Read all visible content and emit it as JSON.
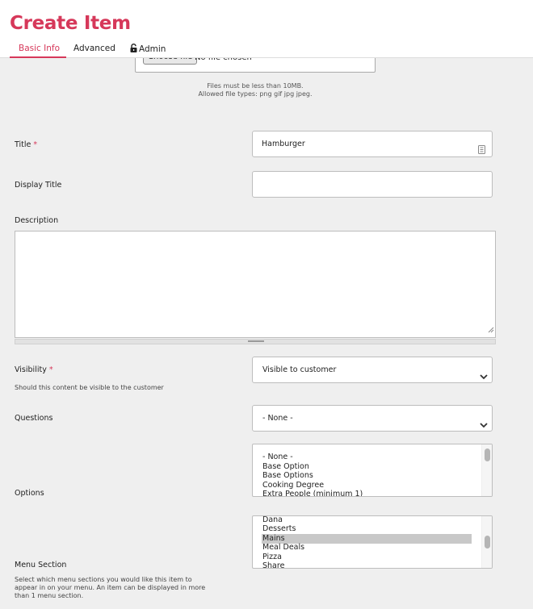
{
  "header": {
    "title": "Create Item",
    "tabs": [
      {
        "label": "Basic Info",
        "active": true
      },
      {
        "label": "Advanced",
        "active": false
      },
      {
        "label": "Admin",
        "active": false,
        "icon": "lock-icon"
      }
    ]
  },
  "image_upload": {
    "button_label": "Choose file",
    "status_text": "No file chosen",
    "help_lines": [
      "Files must be less than 10MB.",
      "Allowed file types: png gif jpg jpeg."
    ]
  },
  "form": {
    "required_marker": "*",
    "title": {
      "label": "Title",
      "value": "Hamburger"
    },
    "display_title": {
      "label": "Display Title",
      "value": ""
    },
    "description": {
      "label": "Description",
      "value": ""
    },
    "visibility": {
      "label": "Visibility",
      "selected": "Visible to customer",
      "hint": "Should this content be visible to the customer"
    },
    "questions": {
      "label": "Questions",
      "selected": "- None -"
    },
    "options": {
      "label": "Options",
      "items": [
        "- None -",
        "Base Option",
        "Base Options",
        "Cooking Degree",
        "Extra People (minimum 1)"
      ]
    },
    "menu_section": {
      "label": "Menu Section",
      "items": [
        "Dana",
        "Desserts",
        "Mains",
        "Meal Deals",
        "Pizza",
        "Share"
      ],
      "selected": "Mains",
      "hint_lines": [
        "Select which menu sections you would like this item to",
        "appear in on your menu. An item can be displayed in more",
        "than 1 menu section."
      ]
    }
  },
  "colors": {
    "accent": "#d6385a",
    "background": "#efefef",
    "selected_option": "#c8c8c8"
  }
}
